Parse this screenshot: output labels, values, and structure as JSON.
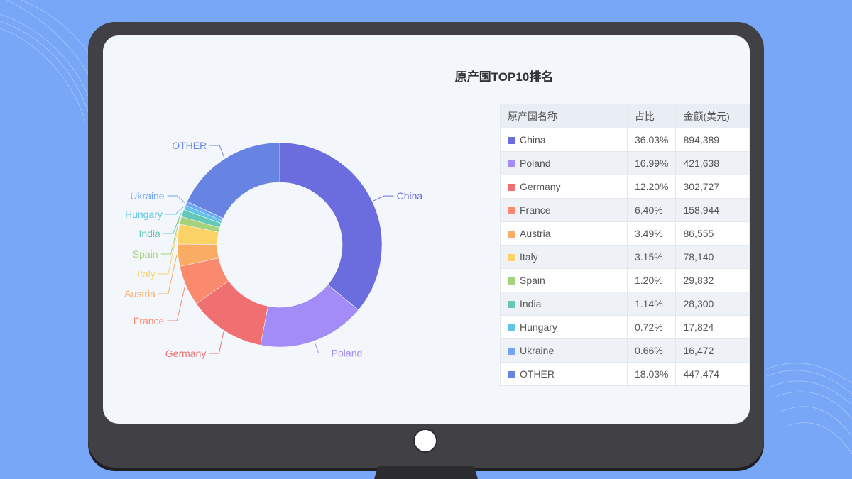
{
  "chart_data": {
    "type": "pie",
    "title": "原产国TOP10排名",
    "categories": [
      "China",
      "Poland",
      "Germany",
      "France",
      "Austria",
      "Italy",
      "Spain",
      "India",
      "Hungary",
      "Ukraine",
      "OTHER"
    ],
    "values": [
      36.03,
      16.99,
      12.2,
      6.4,
      3.49,
      3.15,
      1.2,
      1.14,
      0.72,
      0.66,
      18.03
    ],
    "colors": [
      "#6b6cde",
      "#a38cf6",
      "#f06f71",
      "#f98a6e",
      "#fbac64",
      "#fad266",
      "#a5d27a",
      "#65c7b8",
      "#5fc5e7",
      "#6fa6f8",
      "#6784e3"
    ],
    "table": {
      "headers": [
        "原产国名称",
        "占比",
        "金额(美元)"
      ],
      "rows": [
        {
          "name": "China",
          "pct": "36.03%",
          "amount": "894,389"
        },
        {
          "name": "Poland",
          "pct": "16.99%",
          "amount": "421,638"
        },
        {
          "name": "Germany",
          "pct": "12.20%",
          "amount": "302,727"
        },
        {
          "name": "France",
          "pct": "6.40%",
          "amount": "158,944"
        },
        {
          "name": "Austria",
          "pct": "3.49%",
          "amount": "86,555"
        },
        {
          "name": "Italy",
          "pct": "3.15%",
          "amount": "78,140"
        },
        {
          "name": "Spain",
          "pct": "1.20%",
          "amount": "29,832"
        },
        {
          "name": "India",
          "pct": "1.14%",
          "amount": "28,300"
        },
        {
          "name": "Hungary",
          "pct": "0.72%",
          "amount": "17,824"
        },
        {
          "name": "Ukraine",
          "pct": "0.66%",
          "amount": "16,472"
        },
        {
          "name": "OTHER",
          "pct": "18.03%",
          "amount": "447,474"
        }
      ]
    }
  }
}
